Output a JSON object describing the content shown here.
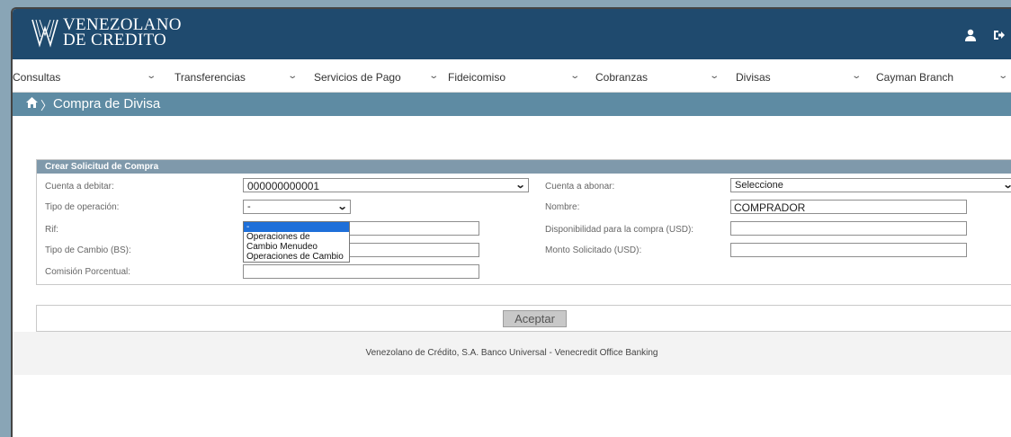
{
  "header": {
    "logo_line1": "VENEZOLANO",
    "logo_line2": "DE CREDITO",
    "icons": [
      "user-icon",
      "logout-icon"
    ],
    "colors": {
      "header_bg": "#1f4a6e",
      "breadcrumb_bg": "#5e8ba3",
      "panel_head_bg": "#7f99ab"
    }
  },
  "nav": {
    "items": [
      {
        "label": "Consultas"
      },
      {
        "label": "Transferencias"
      },
      {
        "label": "Servicios de Pago"
      },
      {
        "label": "Fideicomiso"
      },
      {
        "label": "Cobranzas"
      },
      {
        "label": "Divisas"
      },
      {
        "label": "Cayman Branch"
      }
    ]
  },
  "breadcrumb": {
    "separator": "〉",
    "title": "Compra de Divisa"
  },
  "form": {
    "panel_title": "Crear Solicitud de Compra",
    "cuenta_debitar": {
      "label": "Cuenta a debitar:",
      "value": "000000000001"
    },
    "tipo_operacion": {
      "label": "Tipo de operación:",
      "value": "-",
      "options": [
        "-",
        "Operaciones de Cambio Menudeo",
        "Operaciones de Cambio"
      ]
    },
    "rif": {
      "label": "Rif:",
      "value": ""
    },
    "tipo_cambio": {
      "label": "Tipo de Cambio (BS):",
      "value": ""
    },
    "comision": {
      "label": "Comisión Porcentual:",
      "value": ""
    },
    "cuenta_abonar": {
      "label": "Cuenta a abonar:",
      "value": "Seleccione"
    },
    "nombre": {
      "label": "Nombre:",
      "value": "COMPRADOR"
    },
    "disponibilidad": {
      "label": "Disponibilidad para la compra (USD):",
      "value": ""
    },
    "monto": {
      "label": "Monto Solicitado (USD):",
      "value": ""
    }
  },
  "actions": {
    "accept_label": "Aceptar"
  },
  "footer": {
    "text": "Venezolano de Crédito, S.A. Banco Universal - Venecredit Office Banking"
  }
}
